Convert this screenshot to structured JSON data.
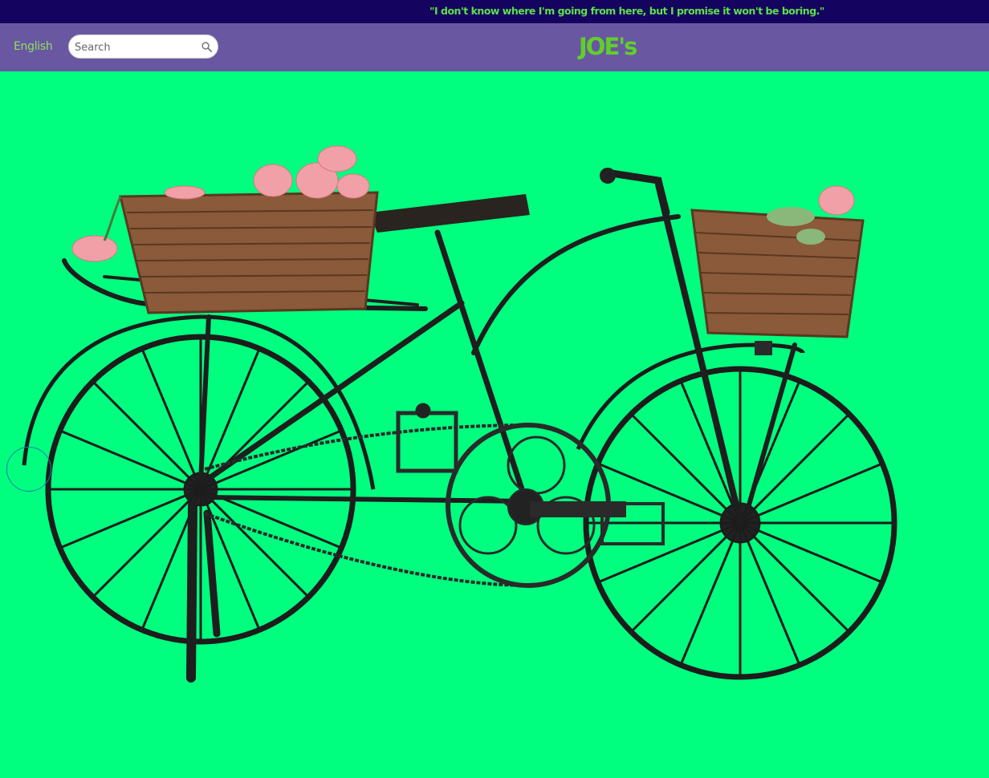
{
  "topbar": {
    "quote": "\"I don't know where I'm going from here, but I promise it won't be boring.\""
  },
  "navbar": {
    "language": "English",
    "search": {
      "placeholder": "Search",
      "value": "",
      "icon": "search-icon"
    },
    "brand": "JOE's"
  },
  "colors": {
    "topbar_bg": "#15045f",
    "navbar_bg": "#6a57a2",
    "accent_green": "#5fd02a",
    "page_bg": "#00ff7f"
  },
  "hero": {
    "image": "bicycle-planter-with-flower-baskets"
  }
}
